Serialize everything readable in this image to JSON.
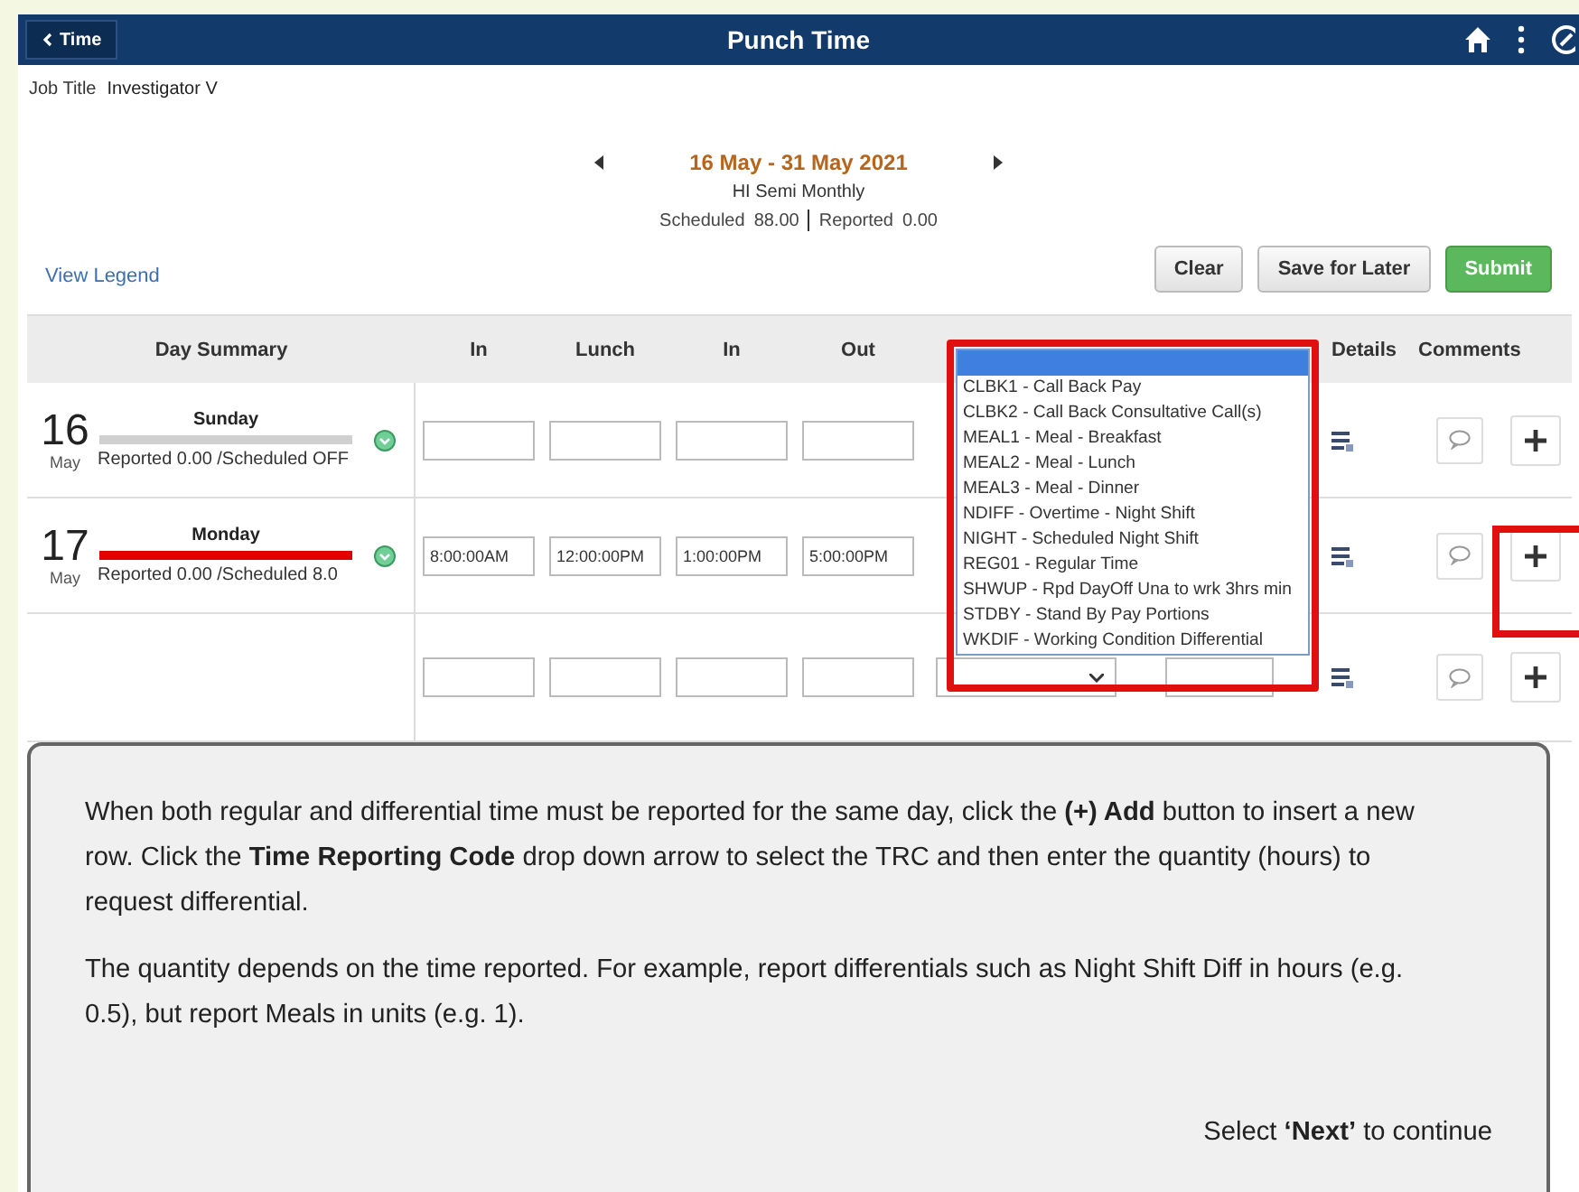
{
  "header": {
    "back_label": "Time",
    "title": "Punch Time"
  },
  "job_title": {
    "label": "Job Title",
    "value": "Investigator V"
  },
  "period": {
    "range": "16 May - 31 May 2021",
    "schedule": "HI Semi Monthly",
    "scheduled_label": "Scheduled",
    "scheduled": "88.00",
    "reported_label": "Reported",
    "reported": "0.00"
  },
  "view_legend": "View Legend",
  "buttons": [
    {
      "label": "Clear",
      "kind": "plain"
    },
    {
      "label": "Save for Later",
      "kind": "plain"
    },
    {
      "label": "Submit",
      "kind": "primary"
    }
  ],
  "columns": [
    "Day Summary",
    "In",
    "Lunch",
    "In",
    "Out",
    "Details",
    "Comments"
  ],
  "days": [
    {
      "day": "16",
      "month": "May",
      "weekday": "Sunday",
      "summary": "Reported 0.00 /Scheduled OFF",
      "color": "#d0d0d0"
    },
    {
      "day": "17",
      "month": "May",
      "weekday": "Monday",
      "summary": "Reported 0.00 /Scheduled 8.0",
      "color": "#e00000"
    }
  ],
  "rows": [
    {
      "kind": "blank"
    },
    {
      "kind": "punched",
      "punches": [
        "8:00:00AM",
        "12:00:00PM",
        "1:00:00PM",
        "5:00:00PM"
      ]
    },
    {
      "kind": "added"
    }
  ],
  "trc_dropdown": {
    "blank_option_selected": true,
    "options": [
      "CLBK1 - Call Back Pay",
      "CLBK2 - Call Back Consultative Call(s)",
      "MEAL1 - Meal - Breakfast",
      "MEAL2 - Meal - Lunch",
      "MEAL3 - Meal - Dinner",
      "NDIFF - Overtime - Night Shift",
      "NIGHT - Scheduled Night Shift",
      "REG01 - Regular Time",
      "SHWUP - Rpd DayOff Una to wrk 3hrs min",
      "STDBY - Stand By Pay Portions",
      "WKDIF - Working Condition Differential"
    ]
  },
  "callout": {
    "paragraphs": [
      "When both regular and differential time must be reported for the same day, click the **(+) Add** button to insert a new row. Click the **Time Reporting Code** drop down arrow to select the TRC and then enter the quantity (hours) to request differential.",
      "The quantity depends on the time reported. For example, report differentials such as Night Shift Diff in hours (e.g. 0.5), but report Meals in units (e.g. 1)."
    ],
    "footer": "Select **‘Next’** to continue"
  }
}
